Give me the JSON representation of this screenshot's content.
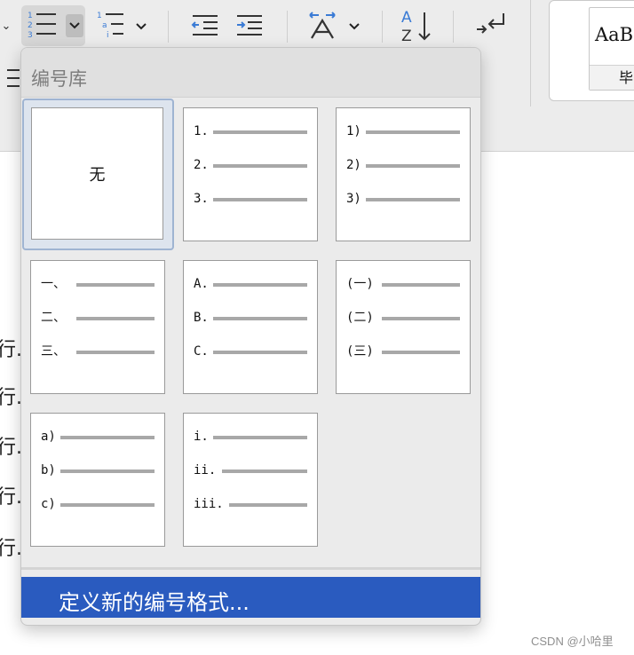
{
  "toolbar": {
    "chev_left": "⌄",
    "numbering_icon": "numbered-list-icon",
    "multilevel_icon": "multilevel-list-icon",
    "decrease_indent_icon": "decrease-indent-icon",
    "increase_indent_icon": "increase-indent-icon",
    "char_spacing_icon": "character-spacing-icon",
    "sort_icon": "sort-az-icon",
    "return_icon": "return-arrow-icon",
    "sort_a": "A",
    "sort_z": "Z"
  },
  "styles_gallery": {
    "sample": "AaB",
    "name": "毕"
  },
  "document": {
    "fragments": [
      "行.",
      "行.",
      "行.",
      "行.",
      "行."
    ]
  },
  "dropdown": {
    "title": "编号库",
    "none_label": "无",
    "tiles": [
      {
        "id": "arabic-dot",
        "labels": [
          "1.",
          "2.",
          "3."
        ]
      },
      {
        "id": "arabic-paren",
        "labels": [
          "1)",
          "2)",
          "3)"
        ]
      },
      {
        "id": "chinese-comma",
        "labels": [
          "一、",
          "二、",
          "三、"
        ]
      },
      {
        "id": "upper-alpha",
        "labels": [
          "A.",
          "B.",
          "C."
        ]
      },
      {
        "id": "chinese-paren",
        "labels": [
          "(一)",
          "(二)",
          "(三)"
        ]
      },
      {
        "id": "lower-alpha-paren",
        "labels": [
          "a)",
          "b)",
          "c)"
        ]
      },
      {
        "id": "lower-roman",
        "labels": [
          "i.",
          "ii.",
          "iii."
        ]
      }
    ],
    "define_new": "定义新的编号格式..."
  },
  "watermark": "CSDN @小哈里",
  "colors": {
    "accent": "#2a5bbf",
    "selected_border": "#9fb4d2",
    "icon_blue": "#3a7bd5"
  }
}
